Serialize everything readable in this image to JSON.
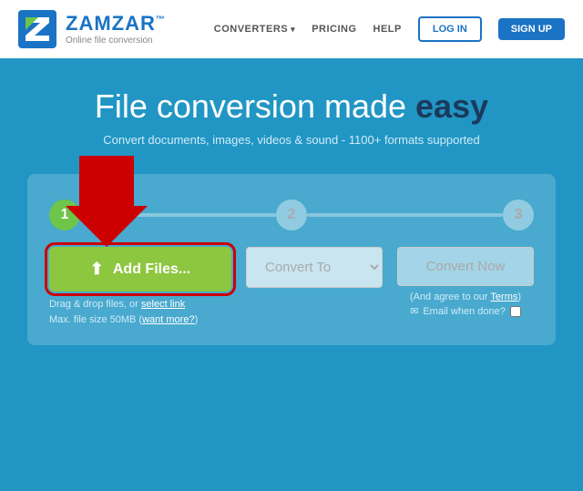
{
  "header": {
    "logo_name": "ZAMZAR",
    "logo_tm": "™",
    "logo_tagline": "Online file conversion",
    "nav": {
      "converters_label": "CONVERTERS",
      "pricing_label": "PRICING",
      "help_label": "HELP",
      "login_label": "LOG IN",
      "signup_label": "SIGN UP"
    }
  },
  "hero": {
    "title_part1": "File ",
    "title_part2": "conversion made ",
    "title_easy": "easy",
    "subtitle": "Convert documents, images, videos & sound - 1100+ formats supported"
  },
  "converter": {
    "step1_label": "1",
    "step2_label": "2",
    "step3_label": "3",
    "add_files_label": "Add Files...",
    "drag_drop_text": "Drag & drop files, or",
    "select_link_label": "select link",
    "max_size_text": "Max. file size 50MB (",
    "want_more_label": "want more?",
    "convert_to_placeholder": "Convert To",
    "convert_now_label": "Convert Now",
    "agree_text": "(And agree to our",
    "terms_label": "Terms",
    "email_label": "Email when done?"
  },
  "icons": {
    "upload": "⬆",
    "dropdown_arrow": "▾",
    "email": "✉"
  }
}
